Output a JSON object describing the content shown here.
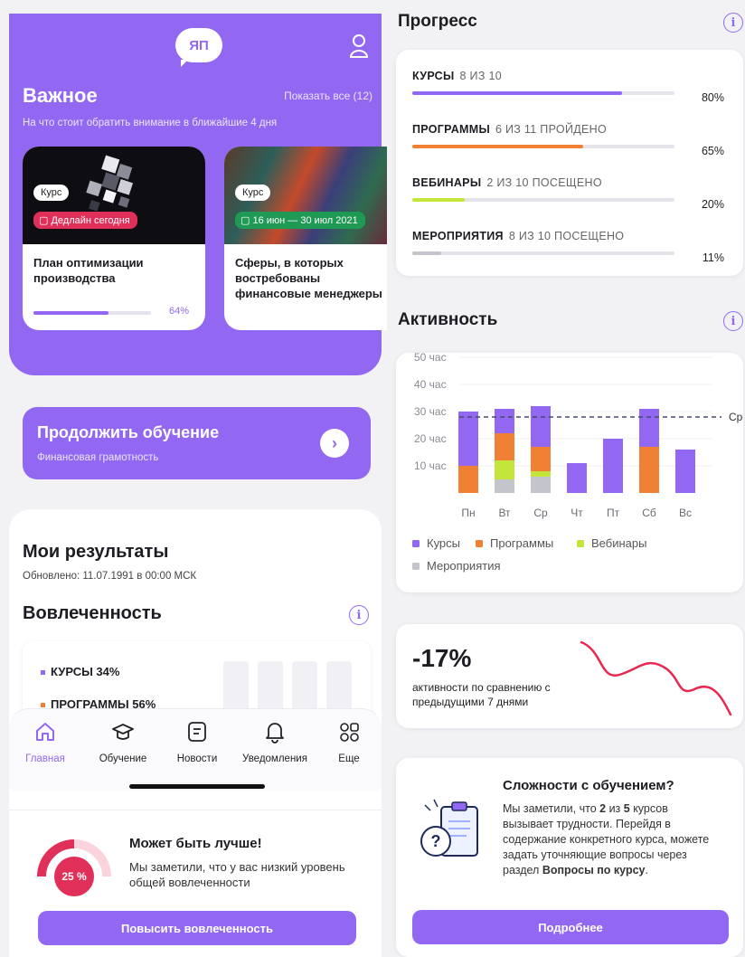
{
  "colors": {
    "accent": "#9268f2",
    "courses": "#9268f2",
    "programs": "#f08033",
    "webinars": "#c4e63c",
    "events": "#c4c4cc",
    "danger": "#e0305a",
    "success": "#1e9a55"
  },
  "header": {
    "logo_text": "ЯП",
    "profile_icon": "user-icon"
  },
  "important": {
    "title": "Важное",
    "show_all": "Показать все (12)",
    "subtitle": "На что стоит обратить внимание в ближайшие 4 дня",
    "cards": [
      {
        "tag": "Курс",
        "badge": "Дедлайн сегодня",
        "title": "План оптимизации производства",
        "progress_label": "64%",
        "progress": 0.64
      },
      {
        "tag": "Курс",
        "badge": "16 июн — 30 июл 2021",
        "title": "Сферы, в которых востребованы финансовые менеджеры"
      }
    ]
  },
  "continue": {
    "title": "Продолжить обучение",
    "subtitle": "Финансовая грамотность"
  },
  "results": {
    "title": "Мои результаты",
    "updated": "Обновлено: 11.07.1991 в 00:00 МСК",
    "engagement_title": "Вовлеченность",
    "items": [
      {
        "label": "КУРСЫ 34%"
      },
      {
        "label": "ПРОГРАММЫ 56%"
      }
    ]
  },
  "tabbar": {
    "items": [
      {
        "label": "Главная",
        "icon": "home-icon",
        "active": true
      },
      {
        "label": "Обучение",
        "icon": "graduation-cap-icon"
      },
      {
        "label": "Новости",
        "icon": "news-icon"
      },
      {
        "label": "Уведомления",
        "icon": "bell-icon"
      },
      {
        "label": "Еще",
        "icon": "more-grid-icon"
      }
    ]
  },
  "better": {
    "gauge_label": "25 %",
    "gauge_value": 0.25,
    "title": "Может быть лучше!",
    "text": "Мы заметили, что у вас низкий уровень общей вовлеченности",
    "button": "Повысить вовлеченность"
  },
  "progress": {
    "title": "Прогресс",
    "rows": [
      {
        "name": "КУРСЫ",
        "detail": "8 ИЗ 10",
        "pct_label": "80%",
        "value": 0.8,
        "color": "#9268f2"
      },
      {
        "name": "ПРОГРАММЫ",
        "detail": "6 ИЗ 11 ПРОЙДЕНО",
        "pct_label": "65%",
        "value": 0.65,
        "color": "#f08033"
      },
      {
        "name": "ВЕБИНАРЫ",
        "detail": "2 ИЗ 10 ПОСЕЩЕНО",
        "pct_label": "20%",
        "value": 0.2,
        "color": "#c4e63c"
      },
      {
        "name": "МЕРОПРИЯТИЯ",
        "detail": "8 ИЗ 10 ПОСЕЩЕНО",
        "pct_label": "11%",
        "value": 0.11,
        "color": "#c4c4cc"
      }
    ]
  },
  "activity": {
    "title": "Активность"
  },
  "chart_data": {
    "type": "bar",
    "stacked": true,
    "categories": [
      "Пн",
      "Вт",
      "Ср",
      "Чт",
      "Пт",
      "Сб",
      "Вс"
    ],
    "y_ticks": [
      "10 час",
      "20 час",
      "30 час",
      "40 час",
      "50 час"
    ],
    "ylim": [
      0,
      50
    ],
    "average": {
      "value": 28,
      "label": "Сред"
    },
    "series": [
      {
        "name": "Мероприятия",
        "color": "#c4c4cc",
        "values": [
          0,
          5,
          6,
          0,
          0,
          0,
          0
        ]
      },
      {
        "name": "Вебинары",
        "color": "#c4e63c",
        "values": [
          0,
          7,
          2,
          0,
          0,
          0,
          0
        ]
      },
      {
        "name": "Программы",
        "color": "#f08033",
        "values": [
          10,
          10,
          9,
          0,
          0,
          17,
          0
        ]
      },
      {
        "name": "Курсы",
        "color": "#9268f2",
        "values": [
          20,
          9,
          15,
          11,
          20,
          14,
          16
        ]
      }
    ],
    "legend": [
      "Курсы",
      "Программы",
      "Вебинары",
      "Мероприятия"
    ]
  },
  "comparison": {
    "value": "-17%",
    "text": "активности по сравнению с предыдущими 7 днями"
  },
  "difficulty": {
    "title": "Сложности с обучением?",
    "text_1": "Мы заметили, что ",
    "count_a": "2",
    "text_2": " из ",
    "count_b": "5",
    "text_3": " курсов вызывает трудности. Перейдя в содержание конкретного курса, можете задать уточняющие вопросы через раздел ",
    "section": "Вопросы по курсу",
    "text_4": ".",
    "button": "Подробнее"
  }
}
